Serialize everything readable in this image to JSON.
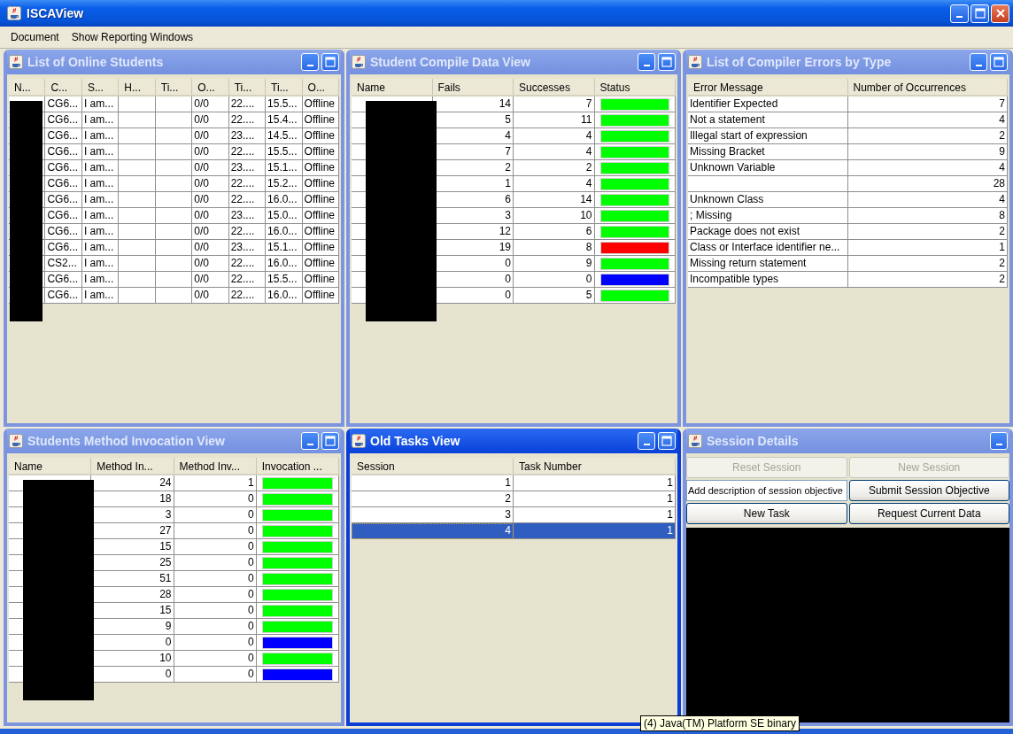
{
  "window": {
    "title": "ISCAView"
  },
  "menu": [
    "Document",
    "Show Reporting Windows"
  ],
  "frames": [
    {
      "kind": "table",
      "title": "List of Online Students",
      "active": false,
      "maximizable": true,
      "redacted": true,
      "columns": [
        {
          "label": "N...",
          "kind": "redacted"
        },
        {
          "label": "C...",
          "kind": "text"
        },
        {
          "label": "S...",
          "kind": "text"
        },
        {
          "label": "H...",
          "kind": "text"
        },
        {
          "label": "Ti...",
          "kind": "text"
        },
        {
          "label": "O...",
          "kind": "text"
        },
        {
          "label": "Ti...",
          "kind": "text"
        },
        {
          "label": "Ti...",
          "kind": "text"
        },
        {
          "label": "O...",
          "kind": "text"
        }
      ],
      "rows": [
        {
          "cells": [
            null,
            "CG6...",
            "I am...",
            null,
            null,
            "0/0",
            "22....",
            "15.5...",
            "Offline"
          ]
        },
        {
          "cells": [
            null,
            "CG6...",
            "I am...",
            null,
            null,
            "0/0",
            "22....",
            "15.4...",
            "Offline"
          ]
        },
        {
          "cells": [
            null,
            "CG6...",
            "I am...",
            null,
            null,
            "0/0",
            "23....",
            "14.5...",
            "Offline"
          ]
        },
        {
          "cells": [
            null,
            "CG6...",
            "I am...",
            null,
            null,
            "0/0",
            "22....",
            "15.5...",
            "Offline"
          ]
        },
        {
          "cells": [
            null,
            "CG6...",
            "I am...",
            null,
            null,
            "0/0",
            "23....",
            "15.1...",
            "Offline"
          ]
        },
        {
          "cells": [
            null,
            "CG6...",
            "I am...",
            null,
            null,
            "0/0",
            "22....",
            "15.2...",
            "Offline"
          ]
        },
        {
          "cells": [
            null,
            "CG6...",
            "I am...",
            null,
            null,
            "0/0",
            "22....",
            "16.0...",
            "Offline"
          ]
        },
        {
          "cells": [
            null,
            "CG6...",
            "I am...",
            null,
            null,
            "0/0",
            "23....",
            "15.0...",
            "Offline"
          ]
        },
        {
          "cells": [
            null,
            "CG6...",
            "I am...",
            null,
            null,
            "0/0",
            "22....",
            "16.0...",
            "Offline"
          ]
        },
        {
          "cells": [
            null,
            "CG6...",
            "I am...",
            null,
            null,
            "0/0",
            "23....",
            "15.1...",
            "Offline"
          ]
        },
        {
          "cells": [
            null,
            "CS2...",
            "I am...",
            null,
            null,
            "0/0",
            "22....",
            "16.0...",
            "Offline"
          ]
        },
        {
          "cells": [
            null,
            "CG6...",
            "I am...",
            null,
            null,
            "0/0",
            "22....",
            "15.5...",
            "Offline"
          ]
        },
        {
          "cells": [
            null,
            "CG6...",
            "I am...",
            null,
            null,
            "0/0",
            "22....",
            "16.0...",
            "Offline"
          ]
        }
      ]
    },
    {
      "kind": "table",
      "title": "Student Compile Data View",
      "active": false,
      "maximizable": true,
      "redacted": true,
      "columns": [
        {
          "label": "Name",
          "kind": "redacted"
        },
        {
          "label": "Fails",
          "kind": "number"
        },
        {
          "label": "Successes",
          "kind": "number"
        },
        {
          "label": "Status",
          "kind": "status"
        }
      ],
      "rows": [
        {
          "cells": [
            null,
            "14",
            "7",
            null
          ],
          "color": "#00ff00"
        },
        {
          "cells": [
            null,
            "5",
            "11",
            null
          ],
          "color": "#00ff00"
        },
        {
          "cells": [
            null,
            "4",
            "4",
            null
          ],
          "color": "#00ff00"
        },
        {
          "cells": [
            null,
            "7",
            "4",
            null
          ],
          "color": "#00ff00"
        },
        {
          "cells": [
            null,
            "2",
            "2",
            null
          ],
          "color": "#00ff00"
        },
        {
          "cells": [
            null,
            "1",
            "4",
            null
          ],
          "color": "#00ff00"
        },
        {
          "cells": [
            null,
            "6",
            "14",
            null
          ],
          "color": "#00ff00"
        },
        {
          "cells": [
            null,
            "3",
            "10",
            null
          ],
          "color": "#00ff00"
        },
        {
          "cells": [
            null,
            "12",
            "6",
            null
          ],
          "color": "#00ff00"
        },
        {
          "cells": [
            null,
            "19",
            "8",
            null
          ],
          "color": "#ff0000"
        },
        {
          "cells": [
            null,
            "0",
            "9",
            null
          ],
          "color": "#00ff00"
        },
        {
          "cells": [
            null,
            "0",
            "0",
            null
          ],
          "color": "#0000ff"
        },
        {
          "cells": [
            null,
            "0",
            "5",
            null
          ],
          "color": "#00ff00"
        }
      ]
    },
    {
      "kind": "table",
      "title": "List of Compiler Errors by Type",
      "active": false,
      "maximizable": true,
      "redacted": false,
      "columns": [
        {
          "label": "Error Message",
          "kind": "text"
        },
        {
          "label": "Number of Occurrences",
          "kind": "number"
        }
      ],
      "rows": [
        {
          "cells": [
            "Identifier Expected",
            "7"
          ]
        },
        {
          "cells": [
            "Not a statement",
            "4"
          ]
        },
        {
          "cells": [
            "Illegal start of expression",
            "2"
          ]
        },
        {
          "cells": [
            "Missing Bracket",
            "9"
          ]
        },
        {
          "cells": [
            "Unknown Variable",
            "4"
          ]
        },
        {
          "cells": [
            null,
            "28"
          ]
        },
        {
          "cells": [
            "Unknown Class",
            "4"
          ]
        },
        {
          "cells": [
            "; Missing",
            "8"
          ]
        },
        {
          "cells": [
            "Package does not exist",
            "2"
          ]
        },
        {
          "cells": [
            "Class or Interface identifier ne...",
            "1"
          ]
        },
        {
          "cells": [
            "Missing return statement",
            "2"
          ]
        },
        {
          "cells": [
            "Incompatible types",
            "2"
          ]
        }
      ]
    },
    {
      "kind": "table",
      "title": "Students Method Invocation View",
      "active": false,
      "maximizable": true,
      "redacted": true,
      "columns": [
        {
          "label": "Name",
          "kind": "redacted"
        },
        {
          "label": "Method In...",
          "kind": "number"
        },
        {
          "label": "Method Inv...",
          "kind": "number"
        },
        {
          "label": "Invocation ...",
          "kind": "status"
        }
      ],
      "rows": [
        {
          "cells": [
            null,
            "24",
            "1",
            null
          ],
          "color": "#00ff00"
        },
        {
          "cells": [
            null,
            "18",
            "0",
            null
          ],
          "color": "#00ff00"
        },
        {
          "cells": [
            null,
            "3",
            "0",
            null
          ],
          "color": "#00ff00"
        },
        {
          "cells": [
            null,
            "27",
            "0",
            null
          ],
          "color": "#00ff00"
        },
        {
          "cells": [
            null,
            "15",
            "0",
            null
          ],
          "color": "#00ff00"
        },
        {
          "cells": [
            null,
            "25",
            "0",
            null
          ],
          "color": "#00ff00"
        },
        {
          "cells": [
            null,
            "51",
            "0",
            null
          ],
          "color": "#00ff00"
        },
        {
          "cells": [
            null,
            "28",
            "0",
            null
          ],
          "color": "#00ff00"
        },
        {
          "cells": [
            null,
            "15",
            "0",
            null
          ],
          "color": "#00ff00"
        },
        {
          "cells": [
            null,
            "9",
            "0",
            null
          ],
          "color": "#00ff00"
        },
        {
          "cells": [
            null,
            "0",
            "0",
            null
          ],
          "color": "#0000ff"
        },
        {
          "cells": [
            null,
            "10",
            "0",
            null
          ],
          "color": "#00ff00"
        },
        {
          "cells": [
            null,
            "0",
            "0",
            null
          ],
          "color": "#0000ff"
        }
      ]
    },
    {
      "kind": "table",
      "title": "Old Tasks View",
      "active": true,
      "maximizable": true,
      "redacted": false,
      "columns": [
        {
          "label": "Session",
          "kind": "number"
        },
        {
          "label": "Task Number",
          "kind": "number"
        }
      ],
      "rows": [
        {
          "cells": [
            "1",
            "1"
          ],
          "selected": false
        },
        {
          "cells": [
            "2",
            "1"
          ],
          "selected": false
        },
        {
          "cells": [
            "3",
            "1"
          ],
          "selected": false
        },
        {
          "cells": [
            "4",
            "1"
          ],
          "selected": true
        }
      ]
    },
    {
      "kind": "session",
      "title": "Session Details",
      "active": false,
      "maximizable": false,
      "controls": [
        {
          "kind": "button",
          "label": "Reset Session",
          "disabled": true
        },
        {
          "kind": "button",
          "label": "New Session",
          "disabled": true
        },
        {
          "kind": "field",
          "value": "Add description of session objective"
        },
        {
          "kind": "button",
          "label": "Submit Session Objective",
          "disabled": false
        },
        {
          "kind": "button",
          "label": "New Task",
          "disabled": false
        },
        {
          "kind": "button",
          "label": "Request Current Data",
          "disabled": false
        }
      ]
    }
  ],
  "tooltip": "(4) Java(TM) Platform SE binary"
}
